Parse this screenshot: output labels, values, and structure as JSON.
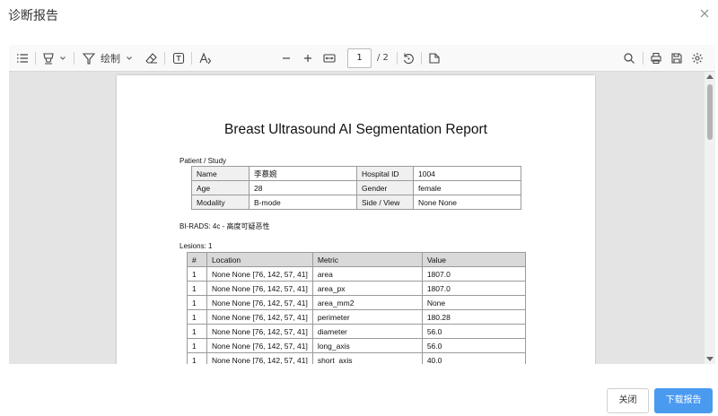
{
  "dialog": {
    "title": "诊断报告"
  },
  "toolbar": {
    "draw_label": "绘制",
    "page_current": "1",
    "page_total": "/ 2"
  },
  "report": {
    "title": "Breast Ultrasound AI Segmentation Report",
    "patient_section": "Patient / Study",
    "patient_rows": [
      [
        "Name",
        "李慕婉",
        "Hospital ID",
        "1004"
      ],
      [
        "Age",
        "28",
        "Gender",
        "female"
      ],
      [
        "Modality",
        "B-mode",
        "Side / View",
        "None None"
      ]
    ],
    "birads": "BI-RADS: 4c - 高度可疑恶性",
    "lesions_label": "Lesions: 1",
    "lesion_headers": [
      "#",
      "Location",
      "Metric",
      "Value"
    ],
    "lesion_rows": [
      [
        "1",
        "None None [76, 142, 57, 41]",
        "area",
        "1807.0"
      ],
      [
        "1",
        "None None [76, 142, 57, 41]",
        "area_px",
        "1807.0"
      ],
      [
        "1",
        "None None [76, 142, 57, 41]",
        "area_mm2",
        "None"
      ],
      [
        "1",
        "None None [76, 142, 57, 41]",
        "perimeter",
        "180.28"
      ],
      [
        "1",
        "None None [76, 142, 57, 41]",
        "diameter",
        "56.0"
      ],
      [
        "1",
        "None None [76, 142, 57, 41]",
        "long_axis",
        "56.0"
      ],
      [
        "1",
        "None None [76, 142, 57, 41]",
        "short_axis",
        "40.0"
      ]
    ]
  },
  "footer": {
    "close_label": "关闭",
    "download_label": "下载报告"
  },
  "colors": {
    "primary": "#4a9af0",
    "viewer_bg": "#e4e4e4",
    "table_header": "#d9d9d9"
  }
}
